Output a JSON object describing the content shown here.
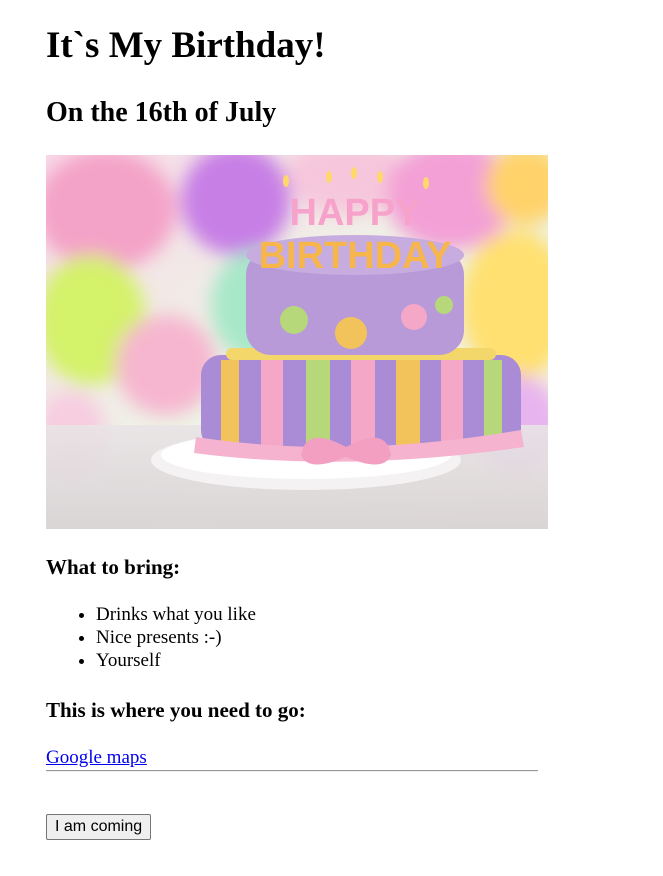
{
  "page": {
    "title": "It`s My Birthday!",
    "subtitle": "On the 16th of July"
  },
  "image": {
    "alt": "Birthday cake",
    "cake_text_line1": "HAPPY",
    "cake_text_line2": "BIRTHDAY"
  },
  "bring": {
    "heading": "What to bring:",
    "items": [
      "Drinks what you like",
      "Nice presents :-)",
      "Yourself"
    ]
  },
  "location": {
    "heading": "This is where you need to go:",
    "link_label": "Google maps"
  },
  "rsvp": {
    "button_label": "I am coming"
  }
}
